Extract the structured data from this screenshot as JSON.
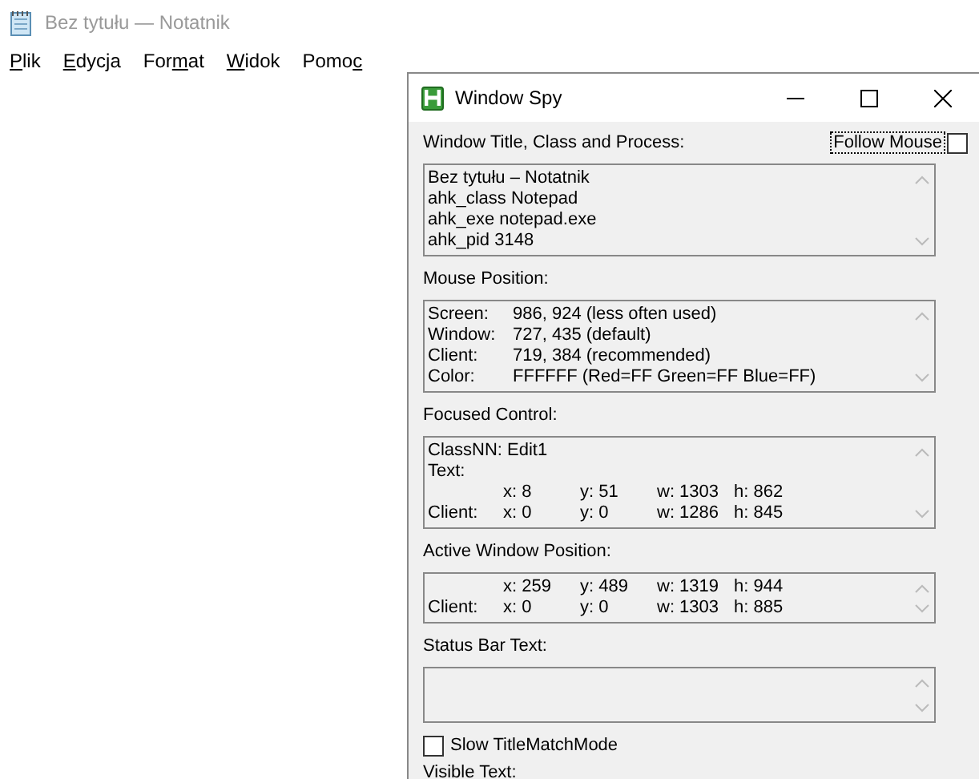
{
  "notepad": {
    "title": "Bez tytułu — Notatnik",
    "menu": [
      {
        "key": "P",
        "after": "lik"
      },
      {
        "key": "E",
        "after": "dycja"
      },
      {
        "before": "For",
        "key": "m",
        "after": "at"
      },
      {
        "key": "W",
        "after": "idok"
      },
      {
        "before": "Pomo",
        "key": "c"
      }
    ]
  },
  "spy": {
    "title": "Window Spy",
    "follow_mouse": {
      "label": "Follow Mouse",
      "checked": false
    },
    "sections": [
      {
        "label": "Window Title, Class and Process:",
        "kind": "plain",
        "lines": [
          {
            "text": "Bez tytułu – Notatnik"
          },
          {
            "text": "ahk_class Notepad"
          },
          {
            "text": "ahk_exe notepad.exe"
          },
          {
            "text": "ahk_pid 3148"
          }
        ]
      },
      {
        "label": "Mouse Position:",
        "kind": "mouse",
        "lines": [
          {
            "label": "Screen:",
            "values": [
              "986, 924 (less often used)"
            ]
          },
          {
            "label": "Window:",
            "values": [
              "727, 435 (default)"
            ]
          },
          {
            "label": "Client:",
            "values": [
              "719, 384 (recommended)"
            ]
          },
          {
            "label": "Color:",
            "values": [
              "FFFFFF (Red=FF Green=FF Blue=FF)"
            ]
          }
        ]
      },
      {
        "label": "Focused Control:",
        "kind": "coords",
        "lines": [
          {
            "text": "ClassNN: Edit1"
          },
          {
            "text": "Text:"
          },
          {
            "values": [
              "x: 8",
              "y: 51",
              "w: 1303",
              "h: 862"
            ]
          },
          {
            "label": "Client:",
            "values": [
              "x: 0",
              "y: 0",
              "w: 1286",
              "h: 845"
            ]
          }
        ]
      },
      {
        "label": "Active Window Position:",
        "kind": "coords",
        "lines": [
          {
            "values": [
              "x: 259",
              "y: 489",
              "w: 1319",
              "h: 944"
            ]
          },
          {
            "label": "Client:",
            "values": [
              "x: 0",
              "y: 0",
              "w: 1303",
              "h: 885"
            ]
          }
        ]
      },
      {
        "label": "Status Bar Text:",
        "kind": "empty"
      }
    ],
    "slow_match": {
      "label": "Slow TitleMatchMode",
      "checked": false
    },
    "visible_text_label": "Visible Text:"
  }
}
